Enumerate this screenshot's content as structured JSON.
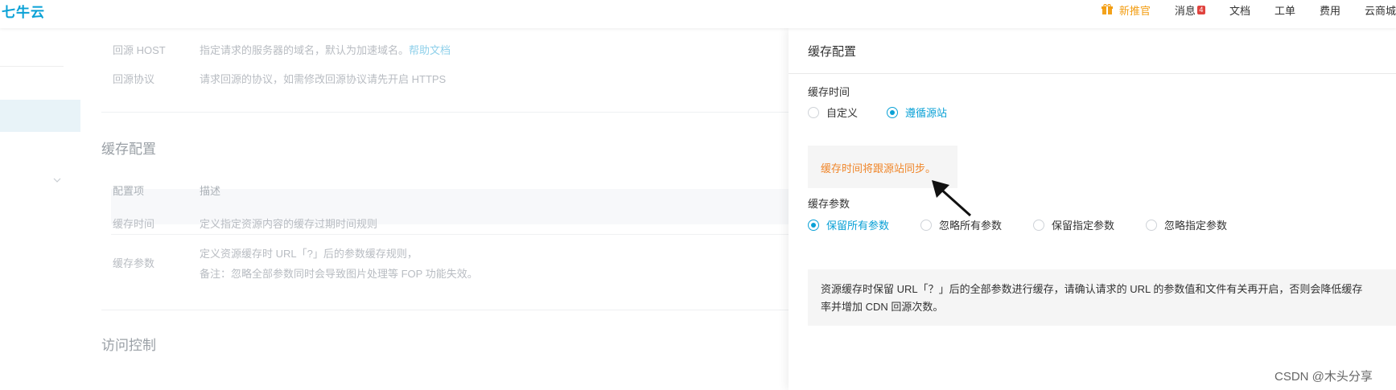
{
  "topbar": {
    "logo": "七牛云",
    "nav": {
      "gift": "新推官",
      "messages": "消息",
      "message_count": "4",
      "docs": "文档",
      "tickets": "工单",
      "billing": "费用",
      "store": "云商城"
    }
  },
  "main": {
    "rows_top": [
      {
        "key": "回源 HOST",
        "desc": "指定请求的服务器的域名，默认为加速域名。",
        "link": "帮助文档"
      },
      {
        "key": "回源协议",
        "desc": "请求回源的协议，如需修改回源协议请先开启 HTTPS"
      }
    ],
    "cache_section_title": "缓存配置",
    "table_header": {
      "col1": "配置项",
      "col2": "描述"
    },
    "cache_rows": [
      {
        "key": "缓存时间",
        "desc": "定义指定资源内容的缓存过期时间规则"
      },
      {
        "key": "缓存参数",
        "desc1": "定义资源缓存时 URL「?」后的参数缓存规则，",
        "desc2": "备注：忽略全部参数同时会导致图片处理等 FOP 功能失效。"
      }
    ],
    "access_section_title": "访问控制"
  },
  "panel": {
    "title": "缓存配置",
    "cache_time_label": "缓存时间",
    "cache_time_options": [
      {
        "label": "自定义",
        "selected": false
      },
      {
        "label": "遵循源站",
        "selected": true
      }
    ],
    "cache_time_note": "缓存时间将跟源站同步。",
    "cache_param_label": "缓存参数",
    "cache_param_options": [
      {
        "label": "保留所有参数",
        "selected": true
      },
      {
        "label": "忽略所有参数",
        "selected": false
      },
      {
        "label": "保留指定参数",
        "selected": false
      },
      {
        "label": "忽略指定参数",
        "selected": false
      }
    ],
    "cache_param_note_line1": "资源缓存时保留 URL「？」后的全部参数进行缓存，请确认请求的 URL 的参数值和文件有关再开启，否则会降低缓存",
    "cache_param_note_line2": "率并增加 CDN 回源次数。"
  },
  "watermark": "CSDN @木头分享",
  "colors": {
    "accent": "#0aa1d6",
    "warning": "#f0862a",
    "badge": "#e0433e"
  }
}
